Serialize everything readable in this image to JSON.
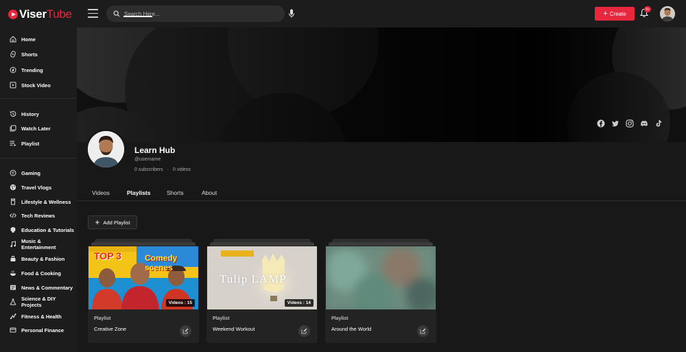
{
  "brand": {
    "name_part1": "Viser",
    "name_part2": "Tube"
  },
  "header": {
    "search_placeholder": "Search Here...",
    "create_label": "Create",
    "notification_count": "9+"
  },
  "sidebar": {
    "groups": [
      {
        "items": [
          {
            "label": "Home",
            "icon": "home-icon"
          },
          {
            "label": "Shorts",
            "icon": "shorts-icon"
          },
          {
            "label": "Trending",
            "icon": "trending-icon"
          },
          {
            "label": "Stock Video",
            "icon": "stock-video-icon"
          }
        ]
      },
      {
        "items": [
          {
            "label": "History",
            "icon": "history-icon"
          },
          {
            "label": "Watch Later",
            "icon": "watch-later-icon"
          },
          {
            "label": "Playlist",
            "icon": "playlist-icon"
          }
        ]
      },
      {
        "items": [
          {
            "label": "Gaming",
            "icon": "gaming-icon"
          },
          {
            "label": "Travel Vlogs",
            "icon": "globe-icon"
          },
          {
            "label": "Lifestyle & Wellness",
            "icon": "lifestyle-icon"
          },
          {
            "label": "Tech Reviews",
            "icon": "code-icon"
          },
          {
            "label": "Education & Tutorials",
            "icon": "education-icon"
          },
          {
            "label": "Music & Entertainment",
            "icon": "music-icon"
          },
          {
            "label": "Beauty & Fashion",
            "icon": "beauty-icon"
          },
          {
            "label": "Food & Cooking",
            "icon": "food-icon"
          },
          {
            "label": "News & Commentary",
            "icon": "news-icon"
          },
          {
            "label": "Science & DIY Projects",
            "icon": "science-icon"
          },
          {
            "label": "Fitness & Health",
            "icon": "fitness-icon"
          },
          {
            "label": "Personal Finance",
            "icon": "finance-icon"
          }
        ]
      }
    ]
  },
  "channel": {
    "name": "Learn Hub",
    "handle": "@username",
    "subscribers": "0 subscribers",
    "separator": "·",
    "videos": "0 videos",
    "socials": [
      "facebook-icon",
      "twitter-icon",
      "instagram-icon",
      "discord-icon",
      "tiktok-icon"
    ]
  },
  "tabs": [
    {
      "label": "Videos"
    },
    {
      "label": "Playlists",
      "active": true
    },
    {
      "label": "Shorts"
    },
    {
      "label": "About"
    }
  ],
  "add_playlist_label": "Add Playlist",
  "playlists": [
    {
      "type": "Playlist",
      "title": "Creative Zone",
      "video_count": "Videos : 15",
      "thumb_text": {
        "top": "TOP 3",
        "right": "Comedy scenes"
      }
    },
    {
      "type": "Playlist",
      "title": "Weekend Workout",
      "video_count": "Videos : 14",
      "thumb_text": {
        "main": "Tulip LAMP"
      }
    },
    {
      "type": "Playlist",
      "title": "Around the World",
      "video_count": ""
    }
  ],
  "colors": {
    "accent": "#e8273f",
    "background": "#181818",
    "panel": "#1c1c1c",
    "card": "#232323"
  }
}
